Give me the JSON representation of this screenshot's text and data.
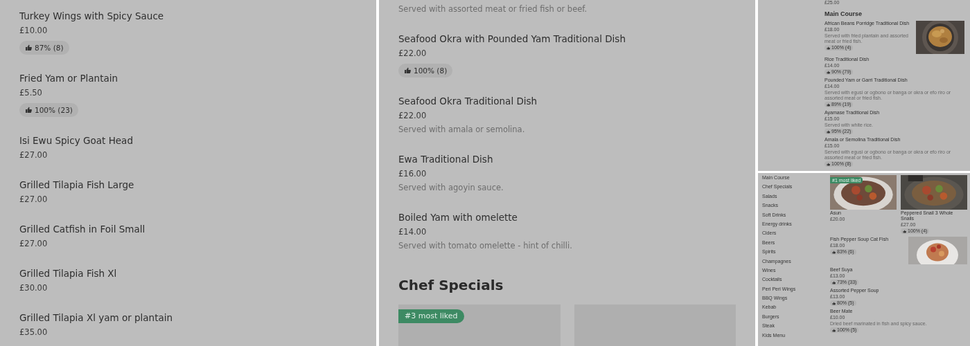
{
  "left_panel": {
    "items": [
      {
        "name": "Turkey Wings with Spicy Sauce",
        "price": "£10.00",
        "rating": "87% (8)"
      },
      {
        "name": "Fried Yam or Plantain",
        "price": "£5.50",
        "rating": "100% (23)"
      },
      {
        "name": "Isi Ewu Spicy Goat Head",
        "price": "£27.00"
      },
      {
        "name": "Grilled Tilapia Fish Large",
        "price": "£27.00"
      },
      {
        "name": "Grilled Catfish in Foil Small",
        "price": "£27.00"
      },
      {
        "name": "Grilled Tilapia Fish Xl",
        "price": "£30.00"
      },
      {
        "name": "Grilled Tilapia Xl yam or plantain",
        "price": "£35.00"
      }
    ]
  },
  "middle_panel": {
    "top_note": "Served with assorted meat or fried fish or beef.",
    "items": [
      {
        "name": "Seafood Okra with Pounded Yam Traditional Dish",
        "price": "£22.00",
        "rating": "100% (8)"
      },
      {
        "name": "Seafood Okra Traditional Dish",
        "price": "£22.00",
        "description": "Served with amala or semolina."
      },
      {
        "name": "Ewa Traditional Dish",
        "price": "£16.00",
        "description": "Served with agoyin sauce."
      },
      {
        "name": "Boiled Yam with omelette",
        "price": "£14.00",
        "description": "Served with tomato omelette - hint of chilli."
      }
    ],
    "section_title": "Chef Specials",
    "cards": [
      {
        "kind": "picture",
        "badge": "#3 most liked"
      },
      {
        "kind": "picture"
      }
    ]
  },
  "right_top_panel": {
    "top_price": "£25.00",
    "section_title": "Main Course",
    "items": [
      {
        "name": "African Beans Porridge Traditional Dish",
        "price": "£18.00",
        "description": "Served with fried plantain and assorted meat or fried fish.",
        "rating": "100% (4)",
        "has_picture": true
      },
      {
        "name": "Rice Traditional Dish",
        "price": "£14.00",
        "rating": "90% (79)",
        "has_picture": false
      },
      {
        "name": "Pounded Yam or Garri Traditional Dish",
        "price": "£14.00",
        "description": "Served with egusi or ogbono or banga or okra or efo riro or assorted meat or fried fish.",
        "rating": "89% (19)",
        "has_picture": false
      },
      {
        "name": "Ayamase Traditional Dish",
        "price": "£15.00",
        "description": "Served with white rice.",
        "rating": "95% (22)",
        "has_picture": false
      },
      {
        "name": "Amala or Semolina Traditional Dish",
        "price": "£15.00",
        "description": "Served with egusi or ogbono or banga or okra or efo riro or assorted meat or fried fish.",
        "rating": "100% (8)",
        "has_picture": false
      }
    ]
  },
  "right_bottom_panel": {
    "categories": [
      "Main Course",
      "Chef Specials",
      "Salads",
      "Snacks",
      "Soft Drinks",
      "Energy drinks",
      "Ciders",
      "Beers",
      "Spirits",
      "Champagnes",
      "Wines",
      "Cocktails",
      "Peri Peri Wings",
      "BBQ Wings",
      "Kebab",
      "Burgers",
      "Steak",
      "Kids Menu"
    ],
    "cards": [
      {
        "name": "Asun",
        "price": "£20.00",
        "badge": "#1 most liked"
      },
      {
        "name": "Peppered Snail 3 Whole Snails",
        "price": "£27.00",
        "rating": "100% (4)"
      }
    ],
    "items": [
      {
        "name": "Fish Pepper Soup Cat Fish",
        "price": "£18.00",
        "rating": "83% (6)",
        "has_picture": true
      },
      {
        "name": "Beef Suya",
        "price": "£13.00",
        "rating": "73% (33)",
        "has_picture": false
      },
      {
        "name": "Assorted Pepper Soup",
        "price": "£13.00",
        "rating": "80% (5)",
        "has_picture": false
      },
      {
        "name": "Beer Mate",
        "price": "£10.00",
        "description": "Dried beef marinated in fish and spicy sauce.",
        "rating": "100% (5)",
        "has_picture": false
      }
    ]
  }
}
